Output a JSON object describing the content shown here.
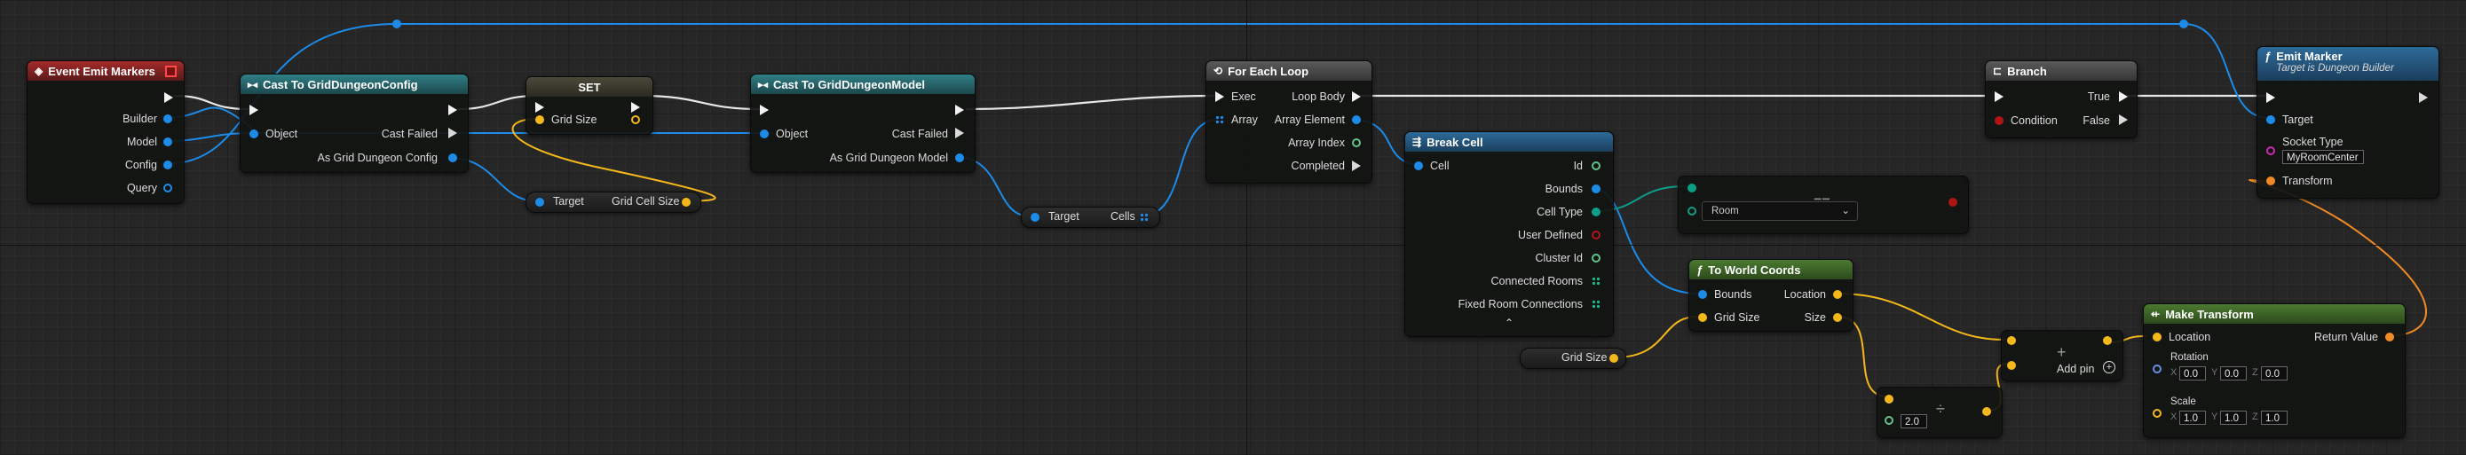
{
  "nodes": {
    "event": {
      "title": "Event Emit Markers",
      "outputs": [
        "Builder",
        "Model",
        "Config",
        "Query"
      ]
    },
    "cast_config": {
      "title": "Cast To GridDungeonConfig",
      "object": "Object",
      "cast_failed": "Cast Failed",
      "as": "As Grid Dungeon Config"
    },
    "set": {
      "title": "SET",
      "grid_size": "Grid Size"
    },
    "grid_cell_size": {
      "target": "Target",
      "output": "Grid Cell Size"
    },
    "cast_model": {
      "title": "Cast To GridDungeonModel",
      "object": "Object",
      "cast_failed": "Cast Failed",
      "as": "As Grid Dungeon Model"
    },
    "cells": {
      "target": "Target",
      "output": "Cells"
    },
    "foreach": {
      "title": "For Each Loop",
      "exec": "Exec",
      "array": "Array",
      "loop_body": "Loop Body",
      "array_element": "Array Element",
      "array_index": "Array Index",
      "completed": "Completed"
    },
    "break_cell": {
      "title": "Break Cell",
      "cell": "Cell",
      "outputs": [
        "Id",
        "Bounds",
        "Cell Type",
        "User Defined",
        "Cluster Id",
        "Connected Rooms",
        "Fixed Room Connections"
      ]
    },
    "equal": {
      "symbol": "==",
      "option": "Room"
    },
    "world_coords": {
      "title": "To World Coords",
      "bounds": "Bounds",
      "grid_size": "Grid Size",
      "location": "Location",
      "size": "Size"
    },
    "grid_size_var": {
      "label": "Grid Size"
    },
    "divide": {
      "value": "2.0",
      "symbol": "÷"
    },
    "add": {
      "symbol": "+",
      "add_pin": "Add pin"
    },
    "branch": {
      "title": "Branch",
      "condition": "Condition",
      "true_label": "True",
      "false_label": "False"
    },
    "emit_marker": {
      "title": "Emit Marker",
      "subtitle": "Target is Dungeon Builder",
      "target": "Target",
      "socket_type": "Socket Type",
      "socket_value": "MyRoomCenter",
      "transform": "Transform"
    },
    "make_transform": {
      "title": "Make Transform",
      "location": "Location",
      "return_value": "Return Value",
      "rotation": "Rotation",
      "rotation_x": "0.0",
      "rotation_y": "0.0",
      "rotation_z": "0.0",
      "scale": "Scale",
      "scale_x": "1.0",
      "scale_y": "1.0",
      "scale_z": "1.0",
      "axis_x": "X",
      "axis_y": "Y",
      "axis_z": "Z"
    }
  },
  "colors": {
    "exec_wire": "#f0f0f0",
    "object_wire": "#1d8be8",
    "vector_wire": "#f5b81b",
    "enum_wire": "#0c9e88",
    "transform_wire": "#f08a24"
  }
}
